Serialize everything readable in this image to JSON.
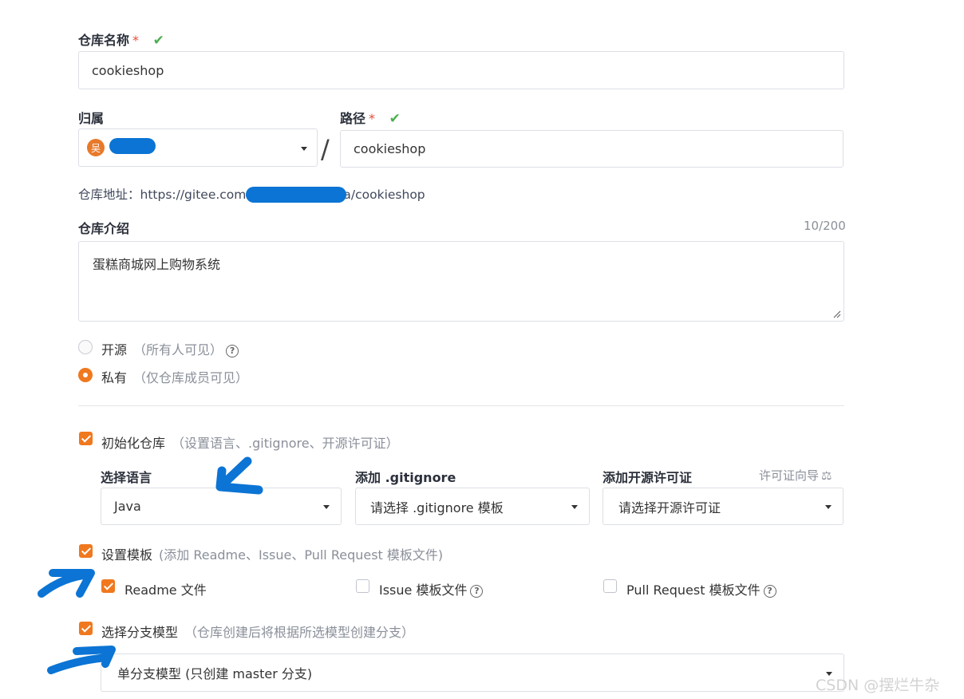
{
  "repo_name": {
    "label": "仓库名称",
    "required_mark": "*",
    "check": "✔",
    "value": "cookieshop"
  },
  "owner": {
    "label": "归属",
    "avatar_text": "吴"
  },
  "path": {
    "label": "路径",
    "required_mark": "*",
    "check": "✔",
    "separator": "/",
    "value": "cookieshop"
  },
  "address": {
    "prefix": "仓库地址：https://gitee.com",
    "suffix": "a/cookieshop"
  },
  "description": {
    "label": "仓库介绍",
    "counter": "10/200",
    "value": "蛋糕商城网上购物系统"
  },
  "visibility": {
    "public": {
      "label": "开源",
      "hint": "（所有人可见）",
      "selected": false
    },
    "private": {
      "label": "私有",
      "hint": "（仅仓库成员可见）",
      "selected": true
    }
  },
  "init_repo": {
    "label": "初始化仓库",
    "hint": "（设置语言、.gitignore、开源许可证）",
    "checked": true,
    "language": {
      "label": "选择语言",
      "value": "Java"
    },
    "gitignore": {
      "label": "添加 .gitignore",
      "value": "请选择 .gitignore 模板"
    },
    "license": {
      "label": "添加开源许可证",
      "guide": "许可证向导",
      "guide_icon": "balance-scale-icon",
      "value": "请选择开源许可证"
    }
  },
  "template": {
    "label": "设置模板",
    "hint": "(添加 Readme、Issue、Pull Request 模板文件)",
    "checked": true,
    "readme": {
      "label": "Readme 文件",
      "checked": true
    },
    "issue": {
      "label": "Issue 模板文件",
      "checked": false
    },
    "pr": {
      "label": "Pull Request 模板文件",
      "checked": false
    }
  },
  "branch": {
    "label": "选择分支模型",
    "hint": "（仓库创建后将根据所选模型创建分支）",
    "checked": true,
    "value": "单分支模型 (只创建 master 分支)"
  },
  "help_glyph": "?",
  "watermark": "CSDN @摆烂牛杂",
  "colors": {
    "accent": "#f0781e",
    "check_green": "#4caf50",
    "required_red": "#e74c3c",
    "annotation_blue": "#0b74d4"
  }
}
